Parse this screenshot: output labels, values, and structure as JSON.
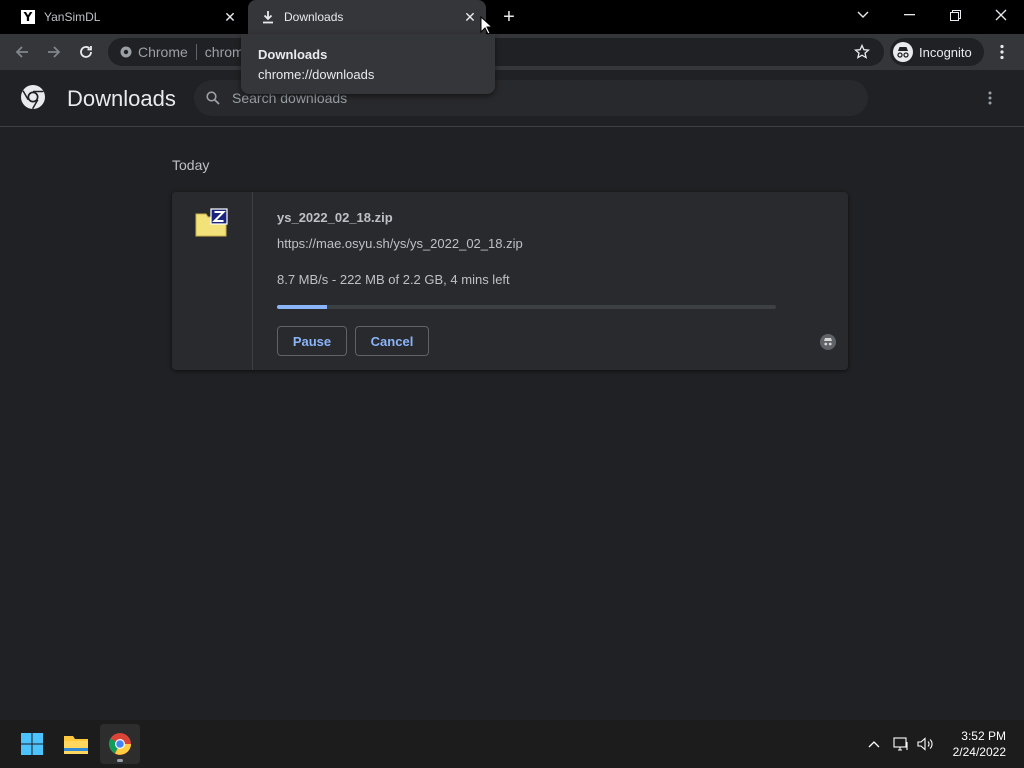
{
  "tabs": [
    {
      "title": "YanSimDL",
      "icon": "yansim-favicon-icon"
    },
    {
      "title": "Downloads",
      "icon": "download-icon"
    }
  ],
  "tooltip": {
    "title": "Downloads",
    "url": "chrome://downloads"
  },
  "omnibox": {
    "site": "Chrome",
    "url": "chrome://downloads"
  },
  "incognito": {
    "label": "Incognito"
  },
  "downloads": {
    "title": "Downloads",
    "search_placeholder": "Search downloads",
    "section": "Today",
    "item": {
      "file_name": "ys_2022_02_18.zip",
      "url": "https://mae.osyu.sh/ys/ys_2022_02_18.zip",
      "status": "8.7 MB/s - 222 MB of 2.2 GB, 4 mins left",
      "progress_fraction": 0.1,
      "pause_label": "Pause",
      "cancel_label": "Cancel"
    }
  },
  "taskbar": {
    "time": "3:52 PM",
    "date": "2/24/2022"
  },
  "colors": {
    "accent": "#8ab4f8",
    "background": "#202124",
    "toolbar": "#35363a"
  }
}
